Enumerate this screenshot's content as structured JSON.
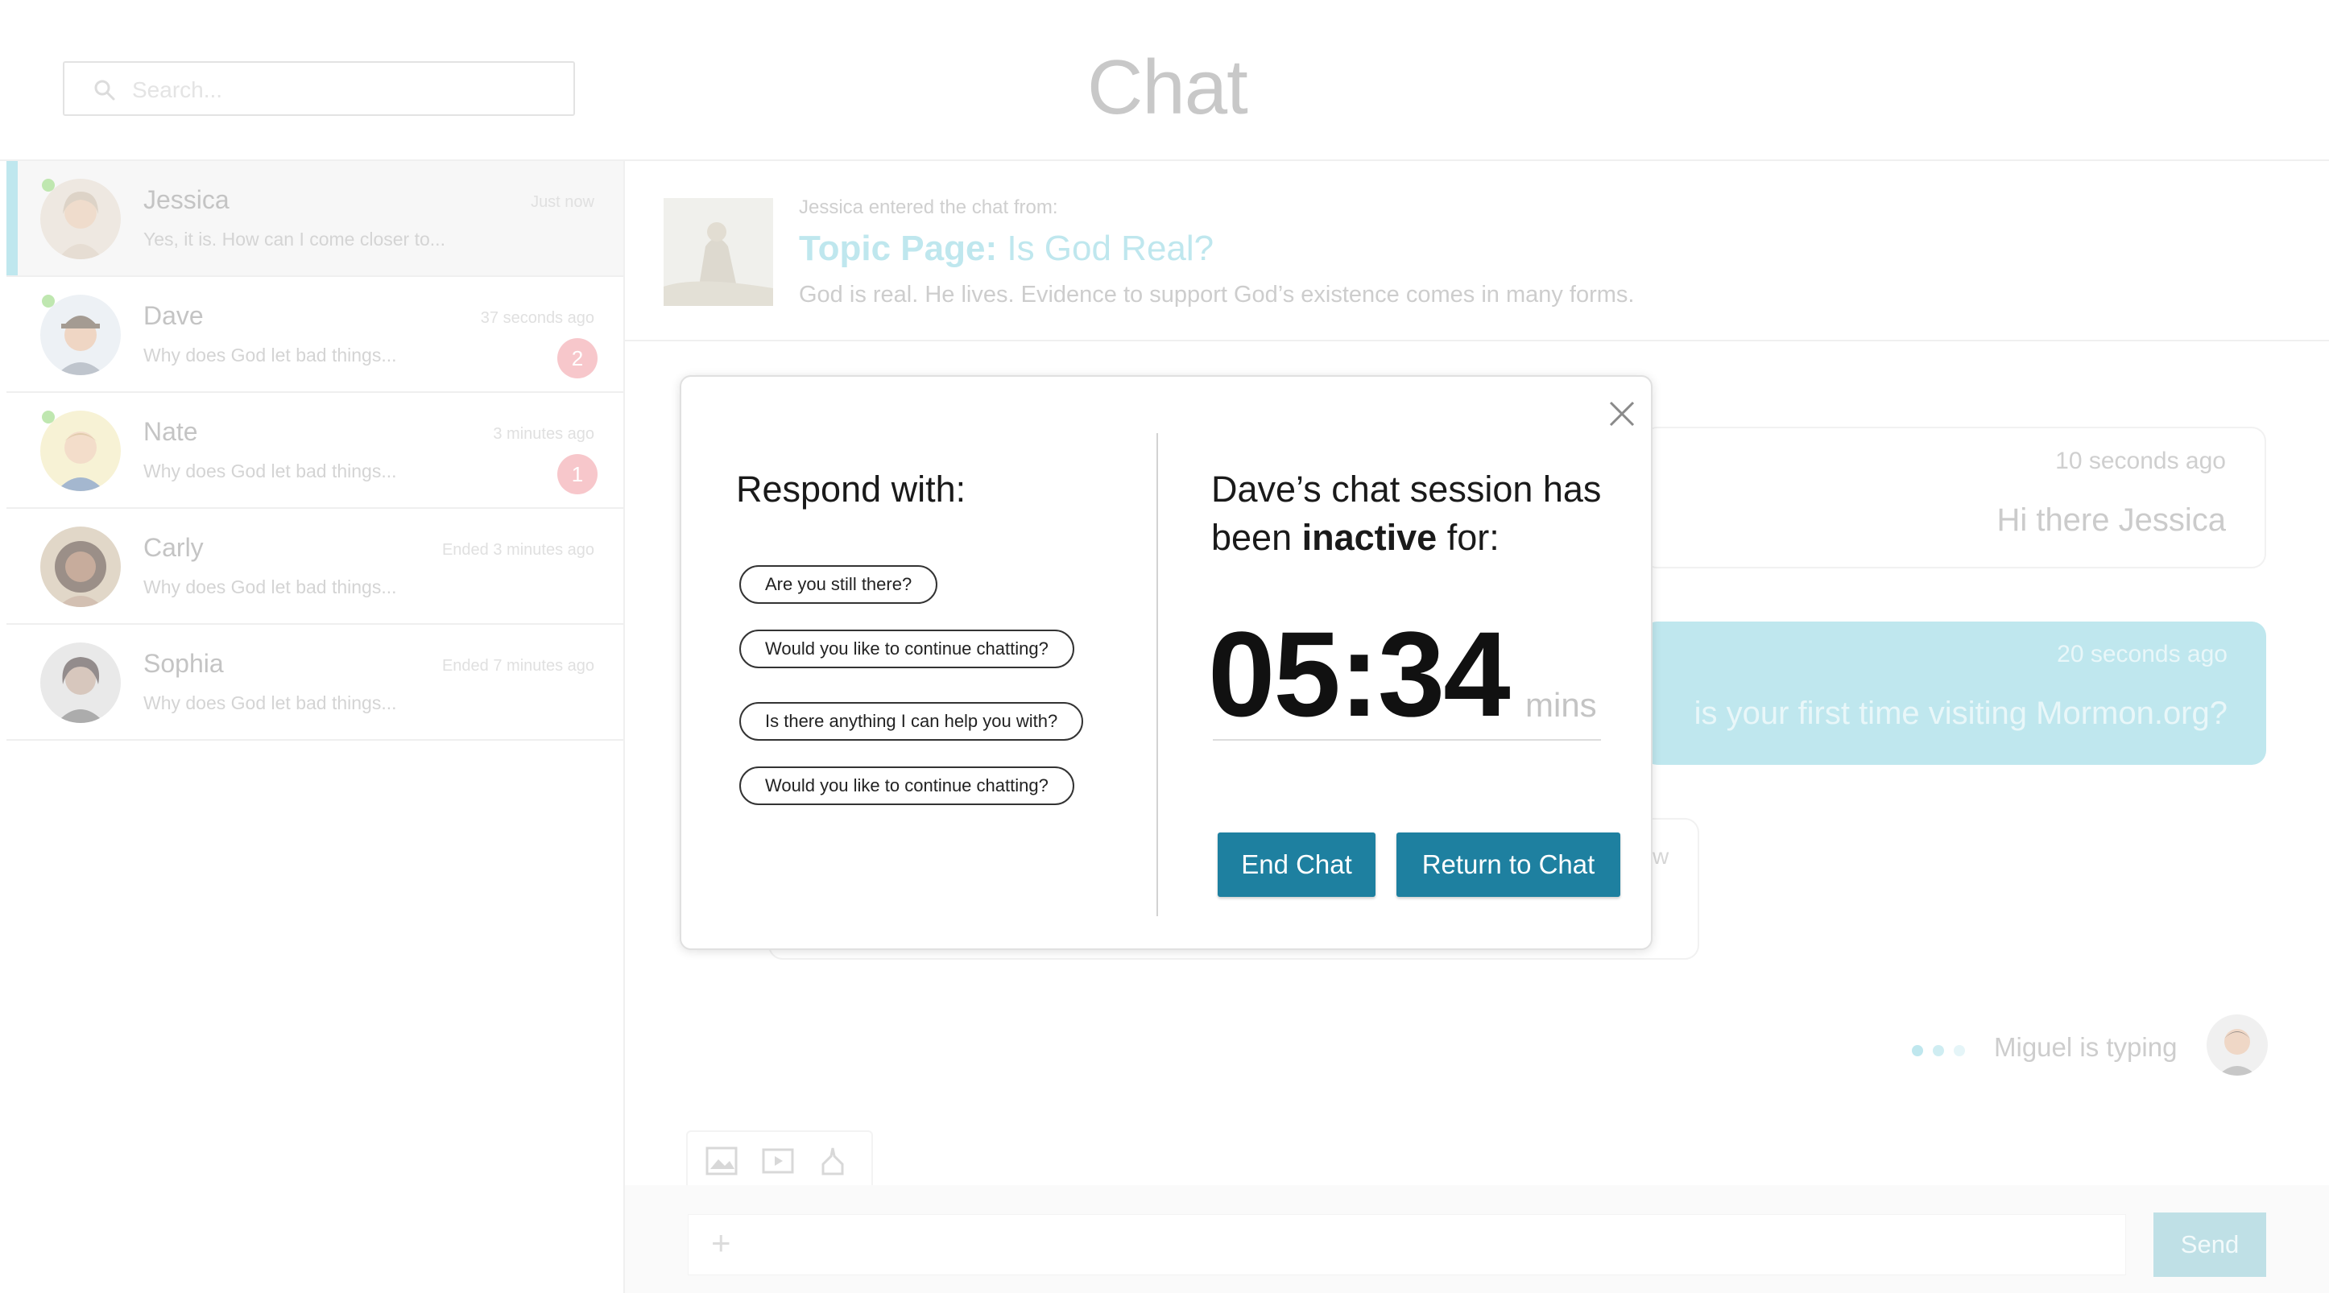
{
  "header": {
    "title": "Chat",
    "search_placeholder": "Search..."
  },
  "conversations": [
    {
      "name": "Jessica",
      "preview": "Yes, it is. How can I come closer to...",
      "time": "Just now",
      "badge": "",
      "online": true,
      "active": true
    },
    {
      "name": "Dave",
      "preview": "Why does God let bad things...",
      "time": "37 seconds ago",
      "badge": "2",
      "online": true,
      "active": false
    },
    {
      "name": "Nate",
      "preview": "Why does God let bad things...",
      "time": "3 minutes ago",
      "badge": "1",
      "online": true,
      "active": false
    },
    {
      "name": "Carly",
      "preview": "Why does God let bad things...",
      "time": "Ended 3 minutes ago",
      "badge": "",
      "online": false,
      "active": false
    },
    {
      "name": "Sophia",
      "preview": "Why does God let bad things...",
      "time": "Ended 7 minutes ago",
      "badge": "",
      "online": false,
      "active": false
    }
  ],
  "source": {
    "intro": "Jessica entered the chat from:",
    "title_prefix": "Topic Page:",
    "title_topic": "Is God Real?",
    "description": "God is real. He lives. Evidence to support God’s existence comes in many forms."
  },
  "messages": [
    {
      "time": "10 seconds ago",
      "text": "Hi there Jessica"
    },
    {
      "time": "20 seconds ago",
      "text": "is your first time visiting Mormon.org?"
    },
    {
      "partial_text": "w"
    }
  ],
  "typing": {
    "label": "Miguel is typing"
  },
  "composer": {
    "send_label": "Send",
    "plus_label": "+"
  },
  "modal": {
    "respond_title": "Respond with:",
    "quick_replies": [
      "Are you still there?",
      "Would you like to continue chatting?",
      "Is there anything I can help you with?",
      "Would you like to continue chatting?"
    ],
    "inactive_prefix": "Dave’s chat session has been ",
    "inactive_bold": "inactive",
    "inactive_suffix": " for:",
    "timer_value": "05:34",
    "timer_unit": "mins",
    "end_chat_label": "End Chat",
    "return_label": "Return to Chat"
  },
  "colors": {
    "accent": "#1e80a0",
    "highlight": "#bfe7ee",
    "badge": "#f7c7cb",
    "online": "#bfe7b0"
  },
  "icons": {
    "search": "search-icon",
    "close": "close-icon",
    "image": "image-icon",
    "video": "video-icon",
    "temple": "temple-icon",
    "plus": "plus-icon"
  }
}
